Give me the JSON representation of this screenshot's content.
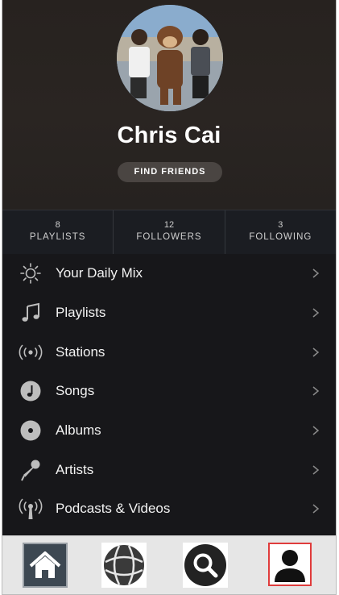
{
  "profile": {
    "name": "Chris Cai",
    "find_friends_label": "FIND FRIENDS"
  },
  "stats": [
    {
      "count": "8",
      "label": "PLAYLISTS"
    },
    {
      "count": "12",
      "label": "FOLLOWERS"
    },
    {
      "count": "3",
      "label": "FOLLOWING"
    }
  ],
  "menu": {
    "items": [
      {
        "label": "Your Daily Mix",
        "icon": "sun-icon"
      },
      {
        "label": "Playlists",
        "icon": "music-note-icon"
      },
      {
        "label": "Stations",
        "icon": "radio-waves-icon"
      },
      {
        "label": "Songs",
        "icon": "song-note-icon"
      },
      {
        "label": "Albums",
        "icon": "album-disc-icon"
      },
      {
        "label": "Artists",
        "icon": "microphone-icon"
      },
      {
        "label": "Podcasts & Videos",
        "icon": "podcast-icon"
      }
    ]
  },
  "tabbar": {
    "tabs": [
      {
        "icon": "home-icon"
      },
      {
        "icon": "browse-globe-icon"
      },
      {
        "icon": "search-icon"
      },
      {
        "icon": "profile-icon",
        "selected": true
      }
    ],
    "selected_outline_color": "#e03c3c"
  },
  "colors": {
    "background": "#17171a",
    "header": "#27221f",
    "text": "#ffffff",
    "icon": "#bdbdbd"
  }
}
